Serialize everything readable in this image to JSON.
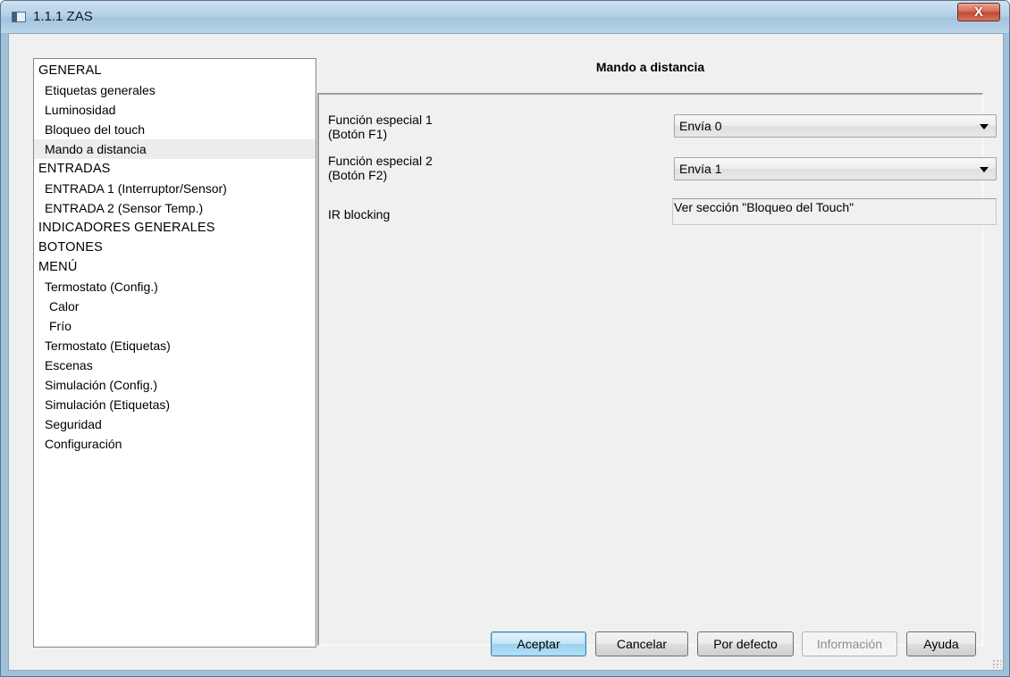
{
  "window": {
    "title": "1.1.1 ZAS",
    "close_label": "X"
  },
  "tree": {
    "items": [
      {
        "label": "GENERAL",
        "level": 0
      },
      {
        "label": "Etiquetas generales",
        "level": 1
      },
      {
        "label": "Luminosidad",
        "level": 1
      },
      {
        "label": "Bloqueo del touch",
        "level": 1
      },
      {
        "label": "Mando a distancia",
        "level": 1,
        "selected": true
      },
      {
        "label": "ENTRADAS",
        "level": 0
      },
      {
        "label": "ENTRADA 1 (Interruptor/Sensor)",
        "level": 1
      },
      {
        "label": "ENTRADA 2 (Sensor Temp.)",
        "level": 1
      },
      {
        "label": "INDICADORES GENERALES",
        "level": 0
      },
      {
        "label": "BOTONES",
        "level": 0
      },
      {
        "label": "MENÚ",
        "level": 0
      },
      {
        "label": "Termostato (Config.)",
        "level": 1
      },
      {
        "label": "Calor",
        "level": 2
      },
      {
        "label": "Frío",
        "level": 2
      },
      {
        "label": "Termostato (Etiquetas)",
        "level": 1
      },
      {
        "label": "Escenas",
        "level": 1
      },
      {
        "label": "Simulación (Config.)",
        "level": 1
      },
      {
        "label": "Simulación (Etiquetas)",
        "level": 1
      },
      {
        "label": "Seguridad",
        "level": 1
      },
      {
        "label": "Configuración",
        "level": 1
      }
    ]
  },
  "panel": {
    "title": "Mando a distancia",
    "params": {
      "f1": {
        "label_line1": "Función especial 1",
        "label_line2": "(Botón F1)",
        "value": "Envía 0"
      },
      "f2": {
        "label_line1": "Función especial 2",
        "label_line2": "(Botón F2)",
        "value": "Envía 1"
      },
      "ir": {
        "label": "IR blocking",
        "value": "Ver sección \"Bloqueo del Touch\""
      }
    }
  },
  "buttons": {
    "accept": "Aceptar",
    "cancel": "Cancelar",
    "default": "Por defecto",
    "info": "Información",
    "help": "Ayuda"
  }
}
